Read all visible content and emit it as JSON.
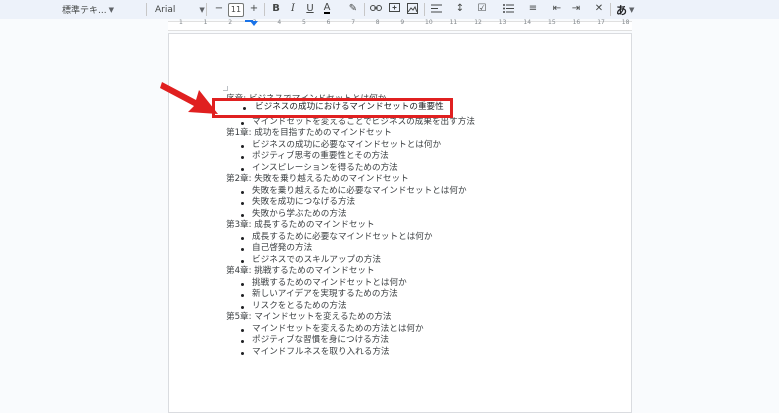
{
  "toolbar": {
    "style_select": "標準テキ...",
    "font_select": "Arial",
    "font_size": "11",
    "decrease_label": "−",
    "increase_label": "+",
    "bold_label": "B",
    "italic_label": "I",
    "underline_label": "U",
    "text_color_label": "A",
    "input_tools_label": "あ"
  },
  "ruler": {
    "numbers": [
      "1",
      "1",
      "2",
      "3",
      "4",
      "5",
      "6",
      "7",
      "8",
      "9",
      "10",
      "11",
      "12",
      "13",
      "14",
      "15",
      "16",
      "17",
      "18"
    ]
  },
  "document": {
    "partial_line_1": "序章: ビジネスでマインドセットとは何か",
    "highlighted_bullet": "ビジネスの成功におけるマインドセットの重要性",
    "partial_line_2": "マインドセットを変えることでビジネスの成果を出す方法",
    "chapters": [
      {
        "title": "第1章: 成功を目指すためのマインドセット",
        "items": [
          "ビジネスの成功に必要なマインドセットとは何か",
          "ポジティブ思考の重要性とその方法",
          "インスピレーションを得るための方法"
        ]
      },
      {
        "title": "第2章: 失敗を乗り越えるためのマインドセット",
        "items": [
          "失敗を乗り越えるために必要なマインドセットとは何か",
          "失敗を成功につなげる方法",
          "失敗から学ぶための方法"
        ]
      },
      {
        "title": "第3章: 成長するためのマインドセット",
        "items": [
          "成長するために必要なマインドセットとは何か",
          "自己啓発の方法",
          "ビジネスでのスキルアップの方法"
        ]
      },
      {
        "title": "第4章: 挑戦するためのマインドセット",
        "items": [
          "挑戦するためのマインドセットとは何か",
          "新しいアイデアを実現するための方法",
          "リスクをとるための方法"
        ]
      },
      {
        "title": "第5章: マインドセットを変えるための方法",
        "items": [
          "マインドセットを変えるための方法とは何か",
          "ポジティブな習慣を身につける方法",
          "マインドフルネスを取り入れる方法"
        ]
      }
    ]
  },
  "colors": {
    "annotation_red": "#e02020",
    "ruler_blue": "#1a73e8"
  }
}
